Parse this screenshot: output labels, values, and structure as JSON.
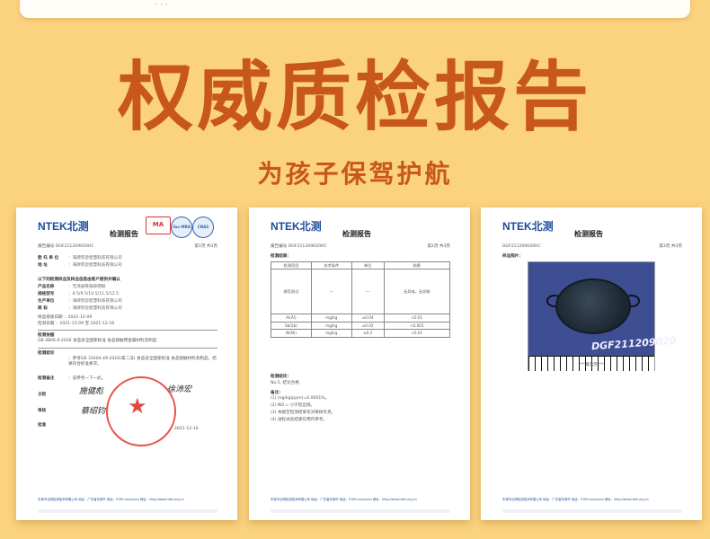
{
  "top_card": {
    "text": "···"
  },
  "header": {
    "title": "权威质检报告",
    "subtitle": "为孩子保驾护航"
  },
  "doc1": {
    "logo_en": "NTEK",
    "logo_cn": "北测",
    "cert_ma": "MA",
    "cert_ilac": "ilac-MRA",
    "cert_cnas": "CNAS",
    "report_title": "检测报告",
    "report_no": "报告编号 DGF211209020HC",
    "page": "第1页 共3页",
    "fields": [
      {
        "k": "委 托 单 位",
        "v": "：海牌宗旨智慧科技有限公司"
      },
      {
        "k": "地 址",
        "v": "：海牌宗旨智慧科技有限公司"
      }
    ],
    "section_sample": "以下的检测样品及样品信息由客户提供并确认",
    "sample_fields": [
      {
        "k": "产品名称",
        "v": "：无涂层铁锅单把锅"
      },
      {
        "k": "规格型号",
        "v": "：8.5/9.5/10.5/11.5/12.5"
      },
      {
        "k": "生产单位",
        "v": "：海牌宗旨智慧科技有限公司"
      },
      {
        "k": "商 标",
        "v": "：海牌宗旨智慧科技有限公司"
      }
    ],
    "recv_date": "样品接收日期  ：2021-12-09",
    "test_date": "检测日期  ：2021-12-09 至 2021-12-16",
    "method_label": "检测依据",
    "method": "GB 4806.9-2016 食品安全国家标准 食品接触用金属材料及制品",
    "result_label": "检测结论",
    "result": "：参考GB 31604.49-2016(第二法) 食品安全国家标准 食品接触材料及制品，结果符合标准要求。",
    "remark_label": "检测备注",
    "remark": "：该参考一下一此。",
    "sig_label_1": "主检",
    "sig_label_2": "审核",
    "sig_label_3": "批准",
    "sign_1": "施健彪",
    "sign_2": "徐沛宏",
    "sign_3": "蔡绍钧",
    "sign_date": "2021-12-16",
    "footer": "东莞市北测检测技术有限公司 地址：广东省东莞市 电话：0769-xxxxxxxx 网址：http://www.ntek.org.cn"
  },
  "doc2": {
    "logo_en": "NTEK",
    "logo_cn": "北测",
    "report_title": "检测报告",
    "report_no": "报告编号 DGF211209020HC",
    "page": "第2页 共3页",
    "section": "检测结果：",
    "table_head": [
      "检测项目",
      "技术条件",
      "单位",
      "结果"
    ],
    "row_sensory": [
      "感官测试",
      "—",
      "—",
      "无异味，无异物"
    ],
    "rows": [
      [
        "Al(Al)",
        "mg/kg",
        "≤0.04",
        "<0.01"
      ],
      [
        "Sb(Sb)",
        "mg/kg",
        "≤0.02",
        "<0.001"
      ],
      [
        "Ni(Ni)",
        "mg/kg",
        "≤0.2",
        "<0.01"
      ]
    ],
    "conclusion_label": "检测结论：",
    "conclusion": "No.5, 结论合格",
    "notes_label": "备注：",
    "notes": [
      "(1) mg/kg(ppm)=0.0001%。",
      "(2) ND = 小于检出限。",
      "(3) 本报告检测结果仅对来样负责。",
      "(4) 进程试验结果仅用作参考。"
    ],
    "footer": "东莞市北测检测技术有限公司 地址：广东省东莞市 电话：0769-xxxxxxxx 网址：http://www.ntek.org.cn"
  },
  "doc3": {
    "logo_en": "NTEK",
    "logo_cn": "北测",
    "report_title": "检测报告",
    "report_no": "DGF211209020HC",
    "page": "第3页 共3页",
    "section": "样品照片：",
    "photo_id": "DGF211209020",
    "caption": "***报告完***",
    "footer": "东莞市北测检测技术有限公司 地址：广东省东莞市 电话：0769-xxxxxxxx 网址：http://www.ntek.org.cn"
  }
}
